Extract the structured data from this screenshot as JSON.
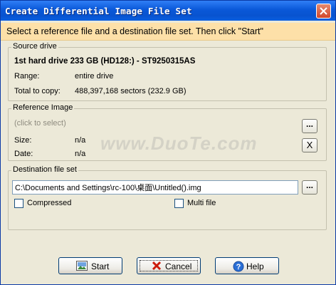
{
  "window": {
    "title": "Create Differential Image File Set"
  },
  "banner": {
    "text": "Select a reference file and a destination file set. Then click \"Start\""
  },
  "source": {
    "legend": "Source drive",
    "drive": "1st hard drive 233 GB (HD128:) - ST9250315AS",
    "range_label": "Range:",
    "range_value": "entire drive",
    "total_label": "Total to copy:",
    "total_value": "488,397,168 sectors (232.9 GB)"
  },
  "reference": {
    "legend": "Reference Image",
    "placeholder": "(click to select)",
    "size_label": "Size:",
    "size_value": "n/a",
    "date_label": "Date:",
    "date_value": "n/a",
    "browse_label": "...",
    "clear_label": "X"
  },
  "destination": {
    "legend": "Destination file set",
    "path": "C:\\Documents and Settings\\rc-100\\桌面\\Untitled().img",
    "browse_label": "...",
    "compressed_label": "Compressed",
    "compressed_checked": false,
    "multifile_label": "Multi file",
    "multifile_checked": false
  },
  "buttons": {
    "start": "Start",
    "cancel": "Cancel",
    "help": "Help"
  },
  "watermark": "www.DuoTe.com",
  "colors": {
    "titlebar": "#0a58d8",
    "banner": "#fde0a8",
    "dialog": "#ece9d8"
  },
  "icons": [
    "close-icon",
    "start-icon",
    "cancel-x-icon",
    "help-icon"
  ]
}
